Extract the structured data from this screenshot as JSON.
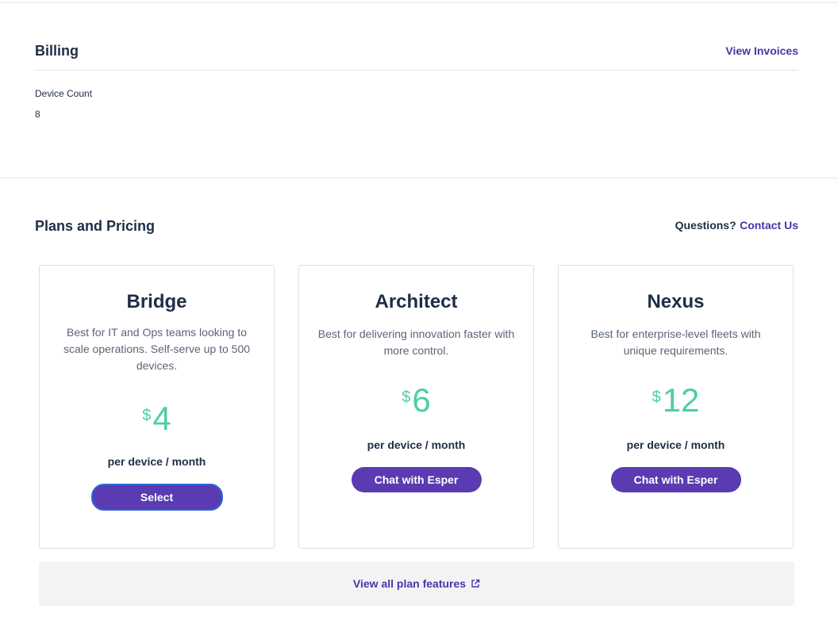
{
  "billing": {
    "title": "Billing",
    "view_invoices": "View Invoices",
    "device_count_label": "Device Count",
    "device_count_value": "8"
  },
  "plans": {
    "title": "Plans and Pricing",
    "questions": "Questions?",
    "contact": "Contact Us",
    "cards": [
      {
        "name": "Bridge",
        "description": "Best for IT and Ops teams looking to scale operations. Self-serve up to 500 devices.",
        "currency": "$",
        "price": "4",
        "period": "per device / month",
        "button": "Select"
      },
      {
        "name": "Architect",
        "description": "Best for delivering innovation faster with more control.",
        "currency": "$",
        "price": "6",
        "period": "per device / month",
        "button": "Chat with Esper"
      },
      {
        "name": "Nexus",
        "description": "Best for enterprise-level fleets with unique requirements.",
        "currency": "$",
        "price": "12",
        "period": "per device / month",
        "button": "Chat with Esper"
      }
    ],
    "features_link": "View all plan features"
  },
  "colors": {
    "accent": "#5a3bb2",
    "link": "#4b33a8",
    "price": "#4fcf9e",
    "heading": "#1f2d47"
  },
  "icons": {
    "features_link": "external-link-icon"
  }
}
